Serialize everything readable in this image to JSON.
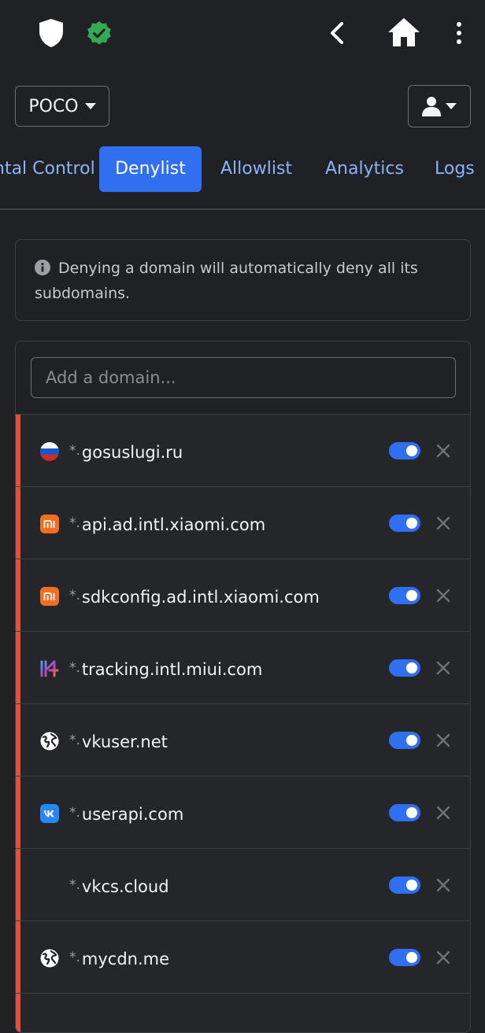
{
  "topbar": {
    "icons": [
      "shield-icon",
      "verified-badge-icon",
      "back-chevron-icon",
      "home-icon",
      "more-vertical-icon"
    ],
    "verified_color": "#34a853"
  },
  "header": {
    "profile_label": "POCO",
    "user_menu_icon": "user-icon"
  },
  "tabs": [
    {
      "label": "ntal Control",
      "active": false
    },
    {
      "label": "Denylist",
      "active": true
    },
    {
      "label": "Allowlist",
      "active": false
    },
    {
      "label": "Analytics",
      "active": false
    },
    {
      "label": "Logs",
      "active": false
    }
  ],
  "notice": {
    "icon": "info-icon",
    "text": "Denying a domain will automatically deny all its subdomains."
  },
  "add_domain": {
    "placeholder": "Add a domain...",
    "value": ""
  },
  "wildcard_prefix": "*.",
  "denylist": [
    {
      "domain": "gosuslugi.ru",
      "favicon": "russia-flag-icon",
      "enabled": true
    },
    {
      "domain": "api.ad.intl.xiaomi.com",
      "favicon": "xiaomi-logo-icon",
      "enabled": true
    },
    {
      "domain": "sdkconfig.ad.intl.xiaomi.com",
      "favicon": "xiaomi-logo-icon",
      "enabled": true
    },
    {
      "domain": "tracking.intl.miui.com",
      "favicon": "miui-logo-icon",
      "enabled": true
    },
    {
      "domain": "vkuser.net",
      "favicon": "globe-icon",
      "enabled": true
    },
    {
      "domain": "userapi.com",
      "favicon": "vk-logo-icon",
      "enabled": true
    },
    {
      "domain": "vkcs.cloud",
      "favicon": "",
      "enabled": true
    },
    {
      "domain": "mycdn.me",
      "favicon": "globe-icon",
      "enabled": true
    }
  ],
  "colors": {
    "accent": "#2f6ff0",
    "deny_bar": "#e0503c",
    "tab_link": "#8ab4f8"
  }
}
